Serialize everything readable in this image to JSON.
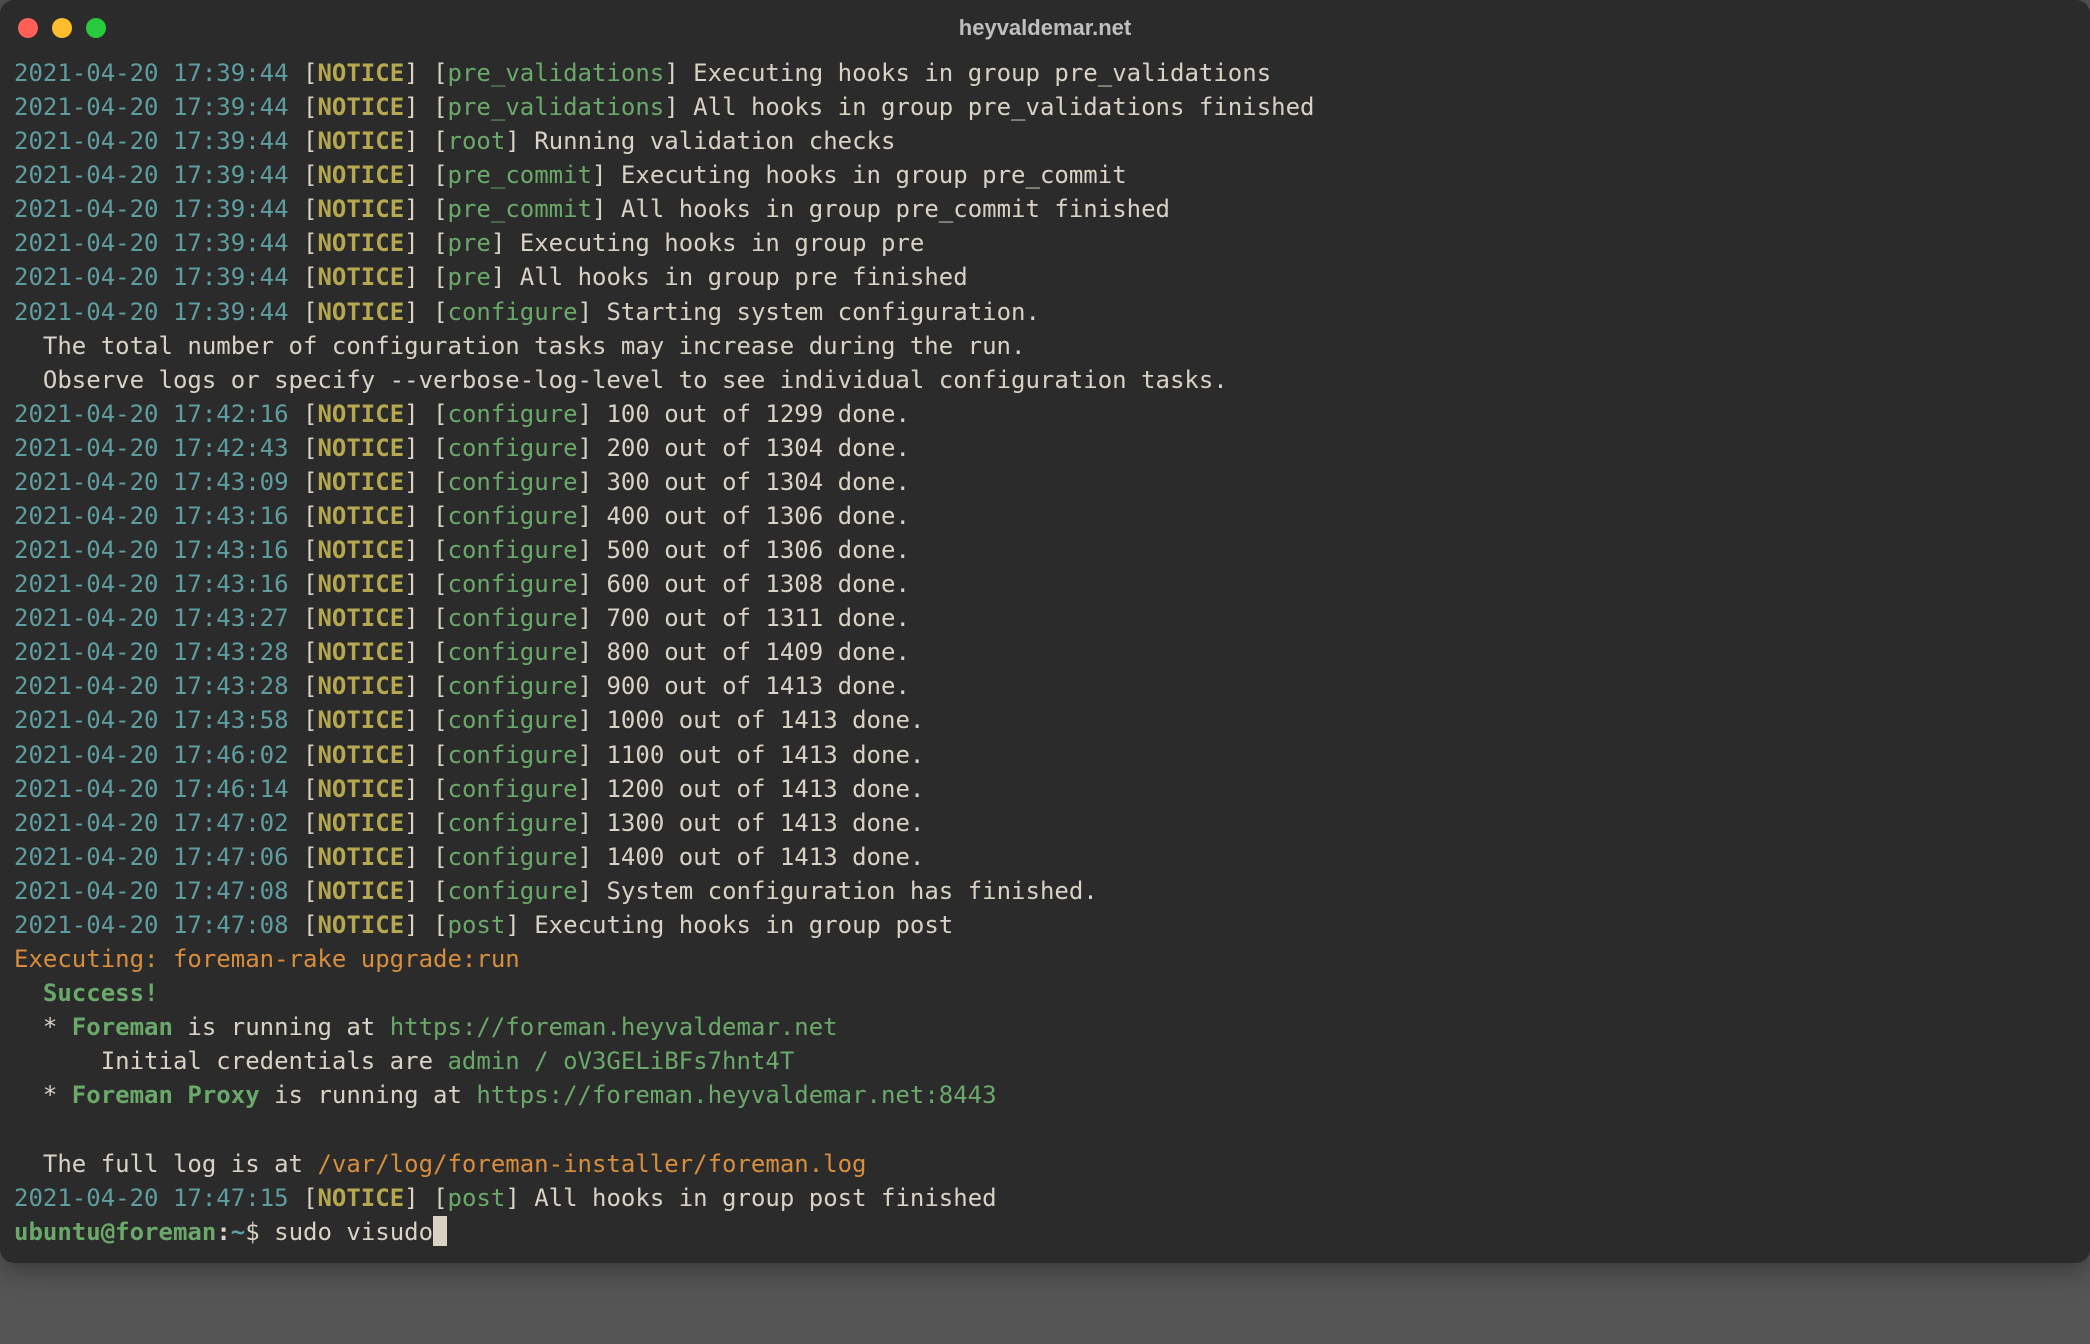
{
  "window": {
    "title": "heyvaldemar.net"
  },
  "colors": {
    "background": "#2b2b2b",
    "timestamp": "#5f9ea0",
    "level": "#b6a84e",
    "tag": "#6aa96a",
    "text": "#d9d2c5",
    "runline": "#d88e3c",
    "success": "#6aa96a",
    "path": "#d88e3c"
  },
  "log": [
    {
      "ts": "2021-04-20 17:39:44",
      "level": "NOTICE",
      "tag": "pre_validations",
      "msg": "Executing hooks in group pre_validations"
    },
    {
      "ts": "2021-04-20 17:39:44",
      "level": "NOTICE",
      "tag": "pre_validations",
      "msg": "All hooks in group pre_validations finished"
    },
    {
      "ts": "2021-04-20 17:39:44",
      "level": "NOTICE",
      "tag": "root",
      "msg": "Running validation checks"
    },
    {
      "ts": "2021-04-20 17:39:44",
      "level": "NOTICE",
      "tag": "pre_commit",
      "msg": "Executing hooks in group pre_commit"
    },
    {
      "ts": "2021-04-20 17:39:44",
      "level": "NOTICE",
      "tag": "pre_commit",
      "msg": "All hooks in group pre_commit finished"
    },
    {
      "ts": "2021-04-20 17:39:44",
      "level": "NOTICE",
      "tag": "pre",
      "msg": "Executing hooks in group pre"
    },
    {
      "ts": "2021-04-20 17:39:44",
      "level": "NOTICE",
      "tag": "pre",
      "msg": "All hooks in group pre finished"
    },
    {
      "ts": "2021-04-20 17:39:44",
      "level": "NOTICE",
      "tag": "configure",
      "msg": "Starting system configuration."
    }
  ],
  "configure_notes": [
    "  The total number of configuration tasks may increase during the run.",
    "  Observe logs or specify --verbose-log-level to see individual configuration tasks."
  ],
  "progress": [
    {
      "ts": "2021-04-20 17:42:16",
      "level": "NOTICE",
      "tag": "configure",
      "msg": "100 out of 1299 done."
    },
    {
      "ts": "2021-04-20 17:42:43",
      "level": "NOTICE",
      "tag": "configure",
      "msg": "200 out of 1304 done."
    },
    {
      "ts": "2021-04-20 17:43:09",
      "level": "NOTICE",
      "tag": "configure",
      "msg": "300 out of 1304 done."
    },
    {
      "ts": "2021-04-20 17:43:16",
      "level": "NOTICE",
      "tag": "configure",
      "msg": "400 out of 1306 done."
    },
    {
      "ts": "2021-04-20 17:43:16",
      "level": "NOTICE",
      "tag": "configure",
      "msg": "500 out of 1306 done."
    },
    {
      "ts": "2021-04-20 17:43:16",
      "level": "NOTICE",
      "tag": "configure",
      "msg": "600 out of 1308 done."
    },
    {
      "ts": "2021-04-20 17:43:27",
      "level": "NOTICE",
      "tag": "configure",
      "msg": "700 out of 1311 done."
    },
    {
      "ts": "2021-04-20 17:43:28",
      "level": "NOTICE",
      "tag": "configure",
      "msg": "800 out of 1409 done."
    },
    {
      "ts": "2021-04-20 17:43:28",
      "level": "NOTICE",
      "tag": "configure",
      "msg": "900 out of 1413 done."
    },
    {
      "ts": "2021-04-20 17:43:58",
      "level": "NOTICE",
      "tag": "configure",
      "msg": "1000 out of 1413 done."
    },
    {
      "ts": "2021-04-20 17:46:02",
      "level": "NOTICE",
      "tag": "configure",
      "msg": "1100 out of 1413 done."
    },
    {
      "ts": "2021-04-20 17:46:14",
      "level": "NOTICE",
      "tag": "configure",
      "msg": "1200 out of 1413 done."
    },
    {
      "ts": "2021-04-20 17:47:02",
      "level": "NOTICE",
      "tag": "configure",
      "msg": "1300 out of 1413 done."
    },
    {
      "ts": "2021-04-20 17:47:06",
      "level": "NOTICE",
      "tag": "configure",
      "msg": "1400 out of 1413 done."
    },
    {
      "ts": "2021-04-20 17:47:08",
      "level": "NOTICE",
      "tag": "configure",
      "msg": "System configuration has finished."
    },
    {
      "ts": "2021-04-20 17:47:08",
      "level": "NOTICE",
      "tag": "post",
      "msg": "Executing hooks in group post"
    }
  ],
  "run_line": "Executing: foreman-rake upgrade:run",
  "success_label": "  Success!",
  "foreman_line": {
    "prefix": "  * ",
    "name": "Foreman",
    "mid": " is running at ",
    "url": "https://foreman.heyvaldemar.net"
  },
  "credentials_line": {
    "prefix": "      Initial credentials are ",
    "creds": "admin / oV3GELiBFs7hnt4T"
  },
  "proxy_line": {
    "prefix": "  * ",
    "name": "Foreman Proxy",
    "mid": " is running at ",
    "url": "https://foreman.heyvaldemar.net:8443"
  },
  "log_path_line": {
    "prefix": "  The full log is at ",
    "path": "/var/log/foreman-installer/foreman.log"
  },
  "final_log": {
    "ts": "2021-04-20 17:47:15",
    "level": "NOTICE",
    "tag": "post",
    "msg": "All hooks in group post finished"
  },
  "prompt": {
    "user": "ubuntu",
    "at": "@",
    "host": "foreman",
    "colon": ":",
    "cwd": "~",
    "dollar": "$ ",
    "command": "sudo visudo"
  }
}
